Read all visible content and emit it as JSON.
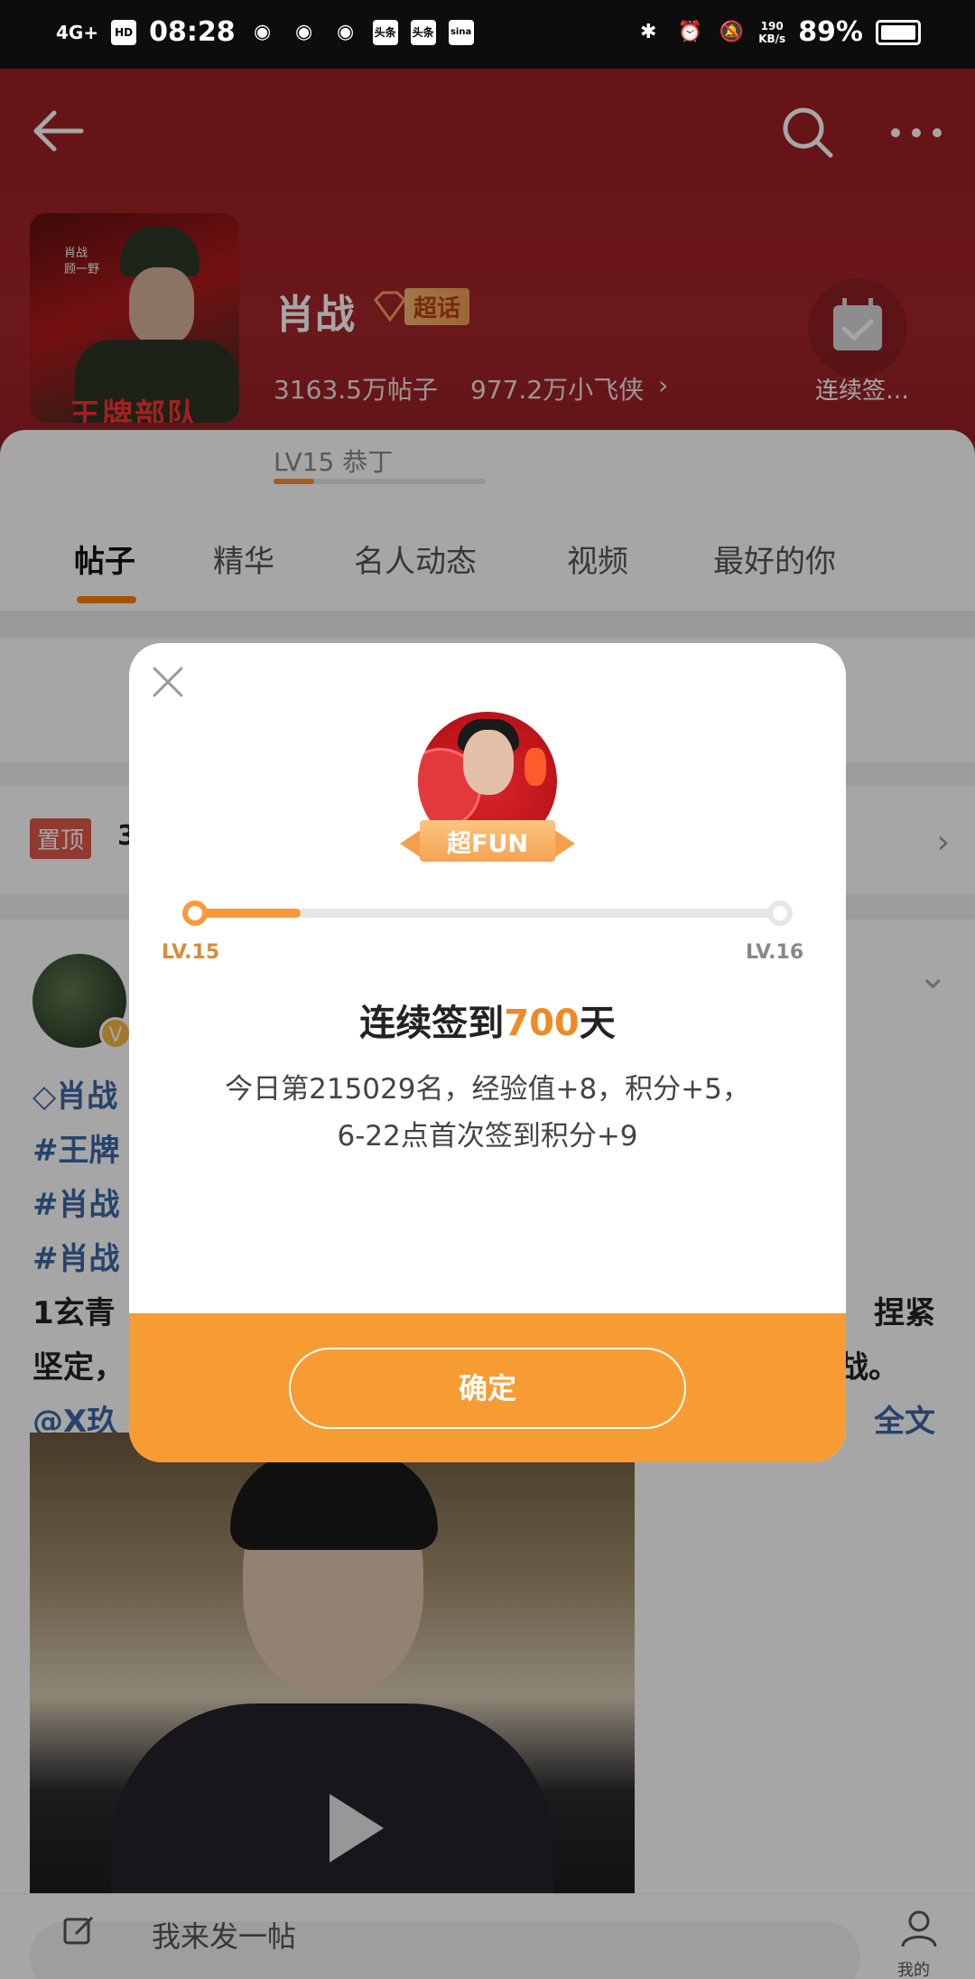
{
  "status_bar": {
    "network": "4G+",
    "hd": "HD",
    "time": "08:28",
    "apps": [
      "头条",
      "头条",
      "sina"
    ],
    "speed_top": "190",
    "speed_unit": "KB/s",
    "battery": "89%"
  },
  "header": {
    "topic_name": "肖战",
    "super_label": "超话",
    "posts_count": "3163.5万帖子",
    "fans_count": "977.2万小飞侠",
    "checkin_label": "连续签…",
    "cover_text": "王牌部队",
    "cover_small": "肖战\n顾一野"
  },
  "level": {
    "label": "LV15 恭丁",
    "progress": 0.19
  },
  "tabs": [
    "帖子",
    "精华",
    "名人动态",
    "视频",
    "最好的你"
  ],
  "pinned": {
    "badge": "置顶",
    "text": "3"
  },
  "post": {
    "line1": "肖战",
    "line2": "#王牌",
    "line3": "#肖战",
    "line4": "#肖战",
    "line5a": "1玄青",
    "line5b": "捏紧",
    "line6a": "坚定，",
    "line6b": "战。",
    "line7a": "@X玖",
    "line7b": "全文",
    "v_badge": "V"
  },
  "bottom": {
    "compose": "我来发一帖",
    "me": "我的"
  },
  "dialog": {
    "ribbon": "超FUN",
    "lv_left": "LV.15",
    "lv_right": "LV.16",
    "progress": 0.18,
    "title_pre": "连续签到",
    "title_num": "700",
    "title_post": "天",
    "line1": "今日第215029名，经验值+8，积分+5，",
    "line2": "6-22点首次签到积分+9",
    "confirm": "确定"
  }
}
